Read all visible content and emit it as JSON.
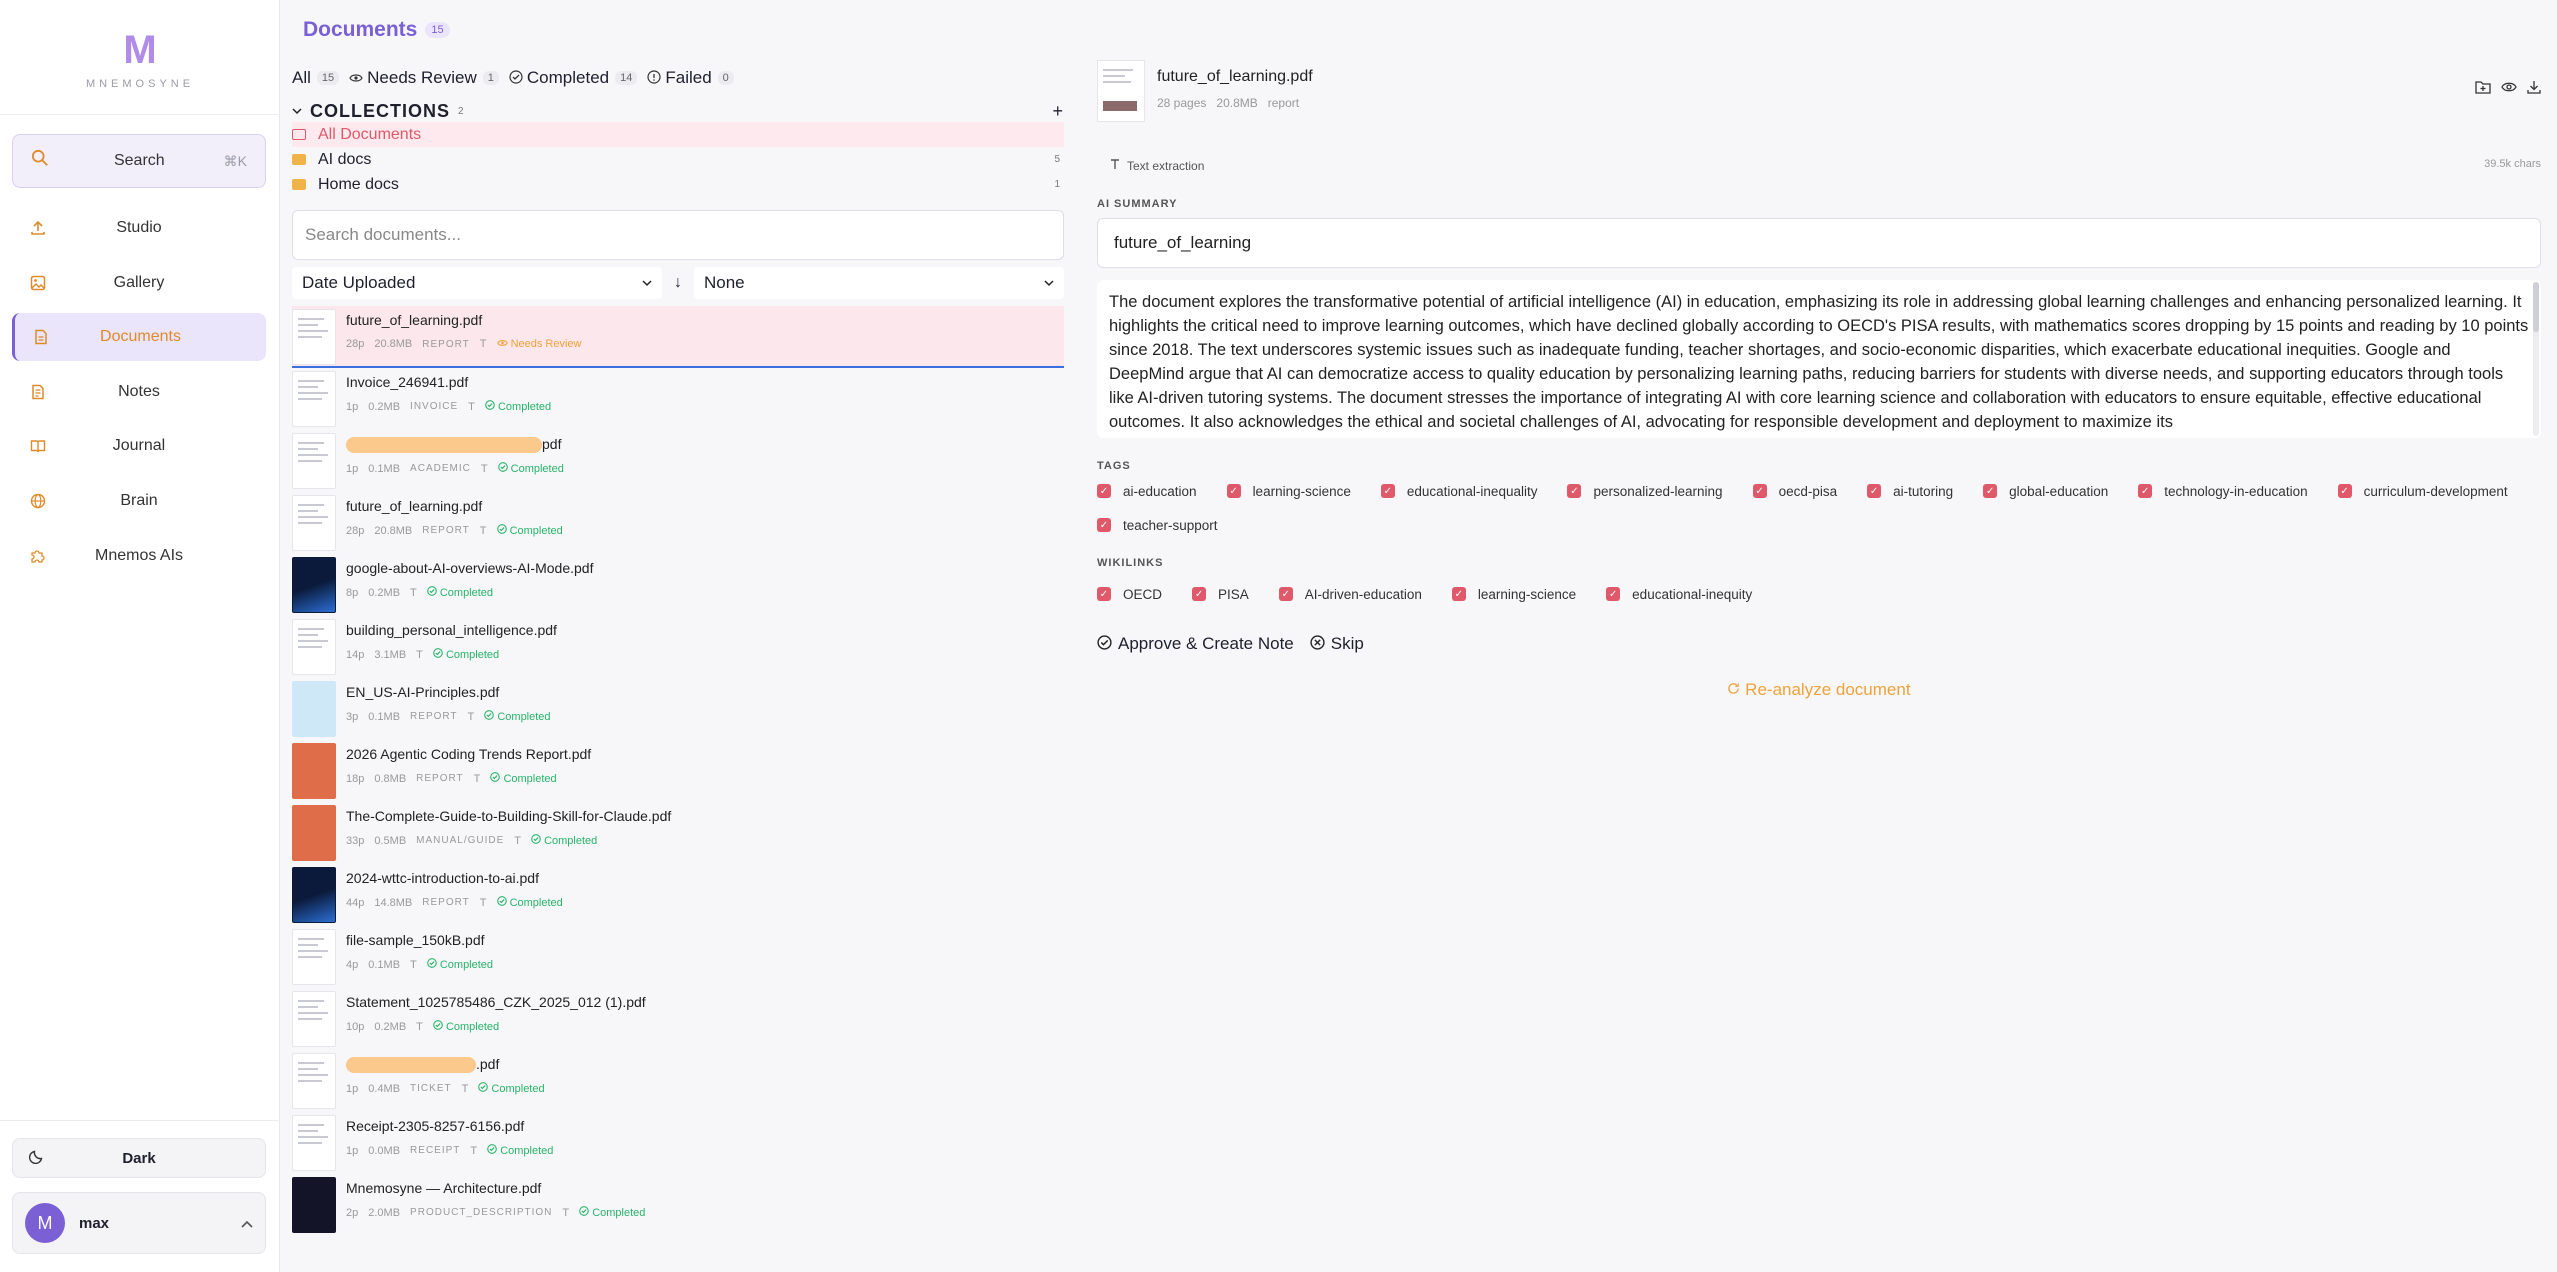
{
  "brand": {
    "logo": "M",
    "name": "MNEMOSYNE",
    "accent": "#b08be8"
  },
  "sidebar": {
    "search_label": "Search",
    "search_shortcut": "⌘K",
    "items": [
      {
        "label": "Studio",
        "icon": "upload-icon"
      },
      {
        "label": "Gallery",
        "icon": "image-icon"
      },
      {
        "label": "Documents",
        "icon": "document-icon",
        "active": true
      },
      {
        "label": "Notes",
        "icon": "note-icon"
      },
      {
        "label": "Journal",
        "icon": "book-icon"
      },
      {
        "label": "Brain",
        "icon": "globe-icon"
      },
      {
        "label": "Mnemos AIs",
        "icon": "puzzle-icon"
      }
    ],
    "theme_label": "Dark",
    "user": {
      "initial": "M",
      "name": "max"
    }
  },
  "documents": {
    "title": "Documents",
    "count": "15",
    "filters": [
      {
        "label": "All",
        "count": "15"
      },
      {
        "label": "Needs Review",
        "count": "1"
      },
      {
        "label": "Completed",
        "count": "14"
      },
      {
        "label": "Failed",
        "count": "0"
      }
    ],
    "collections": {
      "title": "COLLECTIONS",
      "count": "2",
      "plus": "+",
      "items": [
        {
          "label": "All Documents",
          "count": ""
        },
        {
          "label": "AI docs",
          "count": "5"
        },
        {
          "label": "Home docs",
          "count": "1"
        }
      ]
    },
    "search_placeholder": "Search documents...",
    "sort_value": "Date Uploaded",
    "sort_dir": "↓",
    "group_value": "None",
    "list": [
      {
        "name": "future_of_learning.pdf",
        "pages": "28p",
        "size": "20.8MB",
        "type": "REPORT",
        "status": "Needs Review"
      },
      {
        "name": "Invoice_246941.pdf",
        "pages": "1p",
        "size": "0.2MB",
        "type": "INVOICE",
        "status": "Completed"
      },
      {
        "name": "pdf",
        "pages": "1p",
        "size": "0.1MB",
        "type": "ACADEMIC",
        "status": "Completed"
      },
      {
        "name": "future_of_learning.pdf",
        "pages": "28p",
        "size": "20.8MB",
        "type": "REPORT",
        "status": "Completed"
      },
      {
        "name": "google-about-AI-overviews-AI-Mode.pdf",
        "pages": "8p",
        "size": "0.2MB",
        "type": "",
        "status": "Completed"
      },
      {
        "name": "building_personal_intelligence.pdf",
        "pages": "14p",
        "size": "3.1MB",
        "type": "",
        "status": "Completed"
      },
      {
        "name": "EN_US-AI-Principles.pdf",
        "pages": "3p",
        "size": "0.1MB",
        "type": "REPORT",
        "status": "Completed"
      },
      {
        "name": "2026 Agentic Coding Trends Report.pdf",
        "pages": "18p",
        "size": "0.8MB",
        "type": "REPORT",
        "status": "Completed"
      },
      {
        "name": "The-Complete-Guide-to-Building-Skill-for-Claude.pdf",
        "pages": "33p",
        "size": "0.5MB",
        "type": "MANUAL/GUIDE",
        "status": "Completed"
      },
      {
        "name": "2024-wttc-introduction-to-ai.pdf",
        "pages": "44p",
        "size": "14.8MB",
        "type": "REPORT",
        "status": "Completed"
      },
      {
        "name": "file-sample_150kB.pdf",
        "pages": "4p",
        "size": "0.1MB",
        "type": "",
        "status": "Completed"
      },
      {
        "name": "Statement_1025785486_CZK_2025_012 (1).pdf",
        "pages": "10p",
        "size": "0.2MB",
        "type": "",
        "status": "Completed"
      },
      {
        "name": ".pdf",
        "pages": "1p",
        "size": "0.4MB",
        "type": "TICKET",
        "status": "Completed"
      },
      {
        "name": "Receipt-2305-8257-6156.pdf",
        "pages": "1p",
        "size": "0.0MB",
        "type": "RECEIPT",
        "status": "Completed"
      },
      {
        "name": "Mnemosyne — Architecture.pdf",
        "pages": "2p",
        "size": "2.0MB",
        "type": "PRODUCT_DESCRIPTION",
        "status": "Completed"
      }
    ]
  },
  "detail": {
    "filename": "future_of_learning.pdf",
    "pages": "28 pages",
    "size": "20.8MB",
    "type": "report",
    "extraction": "Text extraction",
    "chars": "39.5k chars",
    "summary_label": "AI SUMMARY",
    "summary_title": "future_of_learning",
    "summary_text": "The document explores the transformative potential of artificial intelligence (AI) in education, emphasizing its role in addressing global learning challenges and enhancing personalized learning. It highlights the critical need to improve learning outcomes, which have declined globally according to OECD's PISA results, with mathematics scores dropping by 15 points and reading by 10 points since 2018. The text underscores systemic issues such as inadequate funding, teacher shortages, and socio-economic disparities, which exacerbate educational inequities. Google and DeepMind argue that AI can democratize access to quality education by personalizing learning paths, reducing barriers for students with diverse needs, and supporting educators through tools like AI-driven tutoring systems. The document stresses the importance of integrating AI with core learning science and collaboration with educators to ensure equitable, effective educational outcomes. It also acknowledges the ethical and societal challenges of AI, advocating for responsible development and deployment to maximize its",
    "tags_label": "TAGS",
    "tags": [
      "ai-education",
      "learning-science",
      "educational-inequality",
      "personalized-learning",
      "oecd-pisa",
      "ai-tutoring",
      "global-education",
      "technology-in-education",
      "curriculum-development",
      "teacher-support"
    ],
    "wikilinks_label": "WIKILINKS",
    "wikilinks": [
      "OECD",
      "PISA",
      "AI-driven-education",
      "learning-science",
      "educational-inequity"
    ],
    "approve_label": "Approve & Create Note",
    "skip_label": "Skip",
    "reanalyze_label": "Re-analyze document"
  },
  "colors": {
    "accent": "#7b5fd4",
    "highlight": "#e08a2a",
    "completed": "#27b36a",
    "review": "#f0a23a",
    "tag": "#e0596a"
  }
}
